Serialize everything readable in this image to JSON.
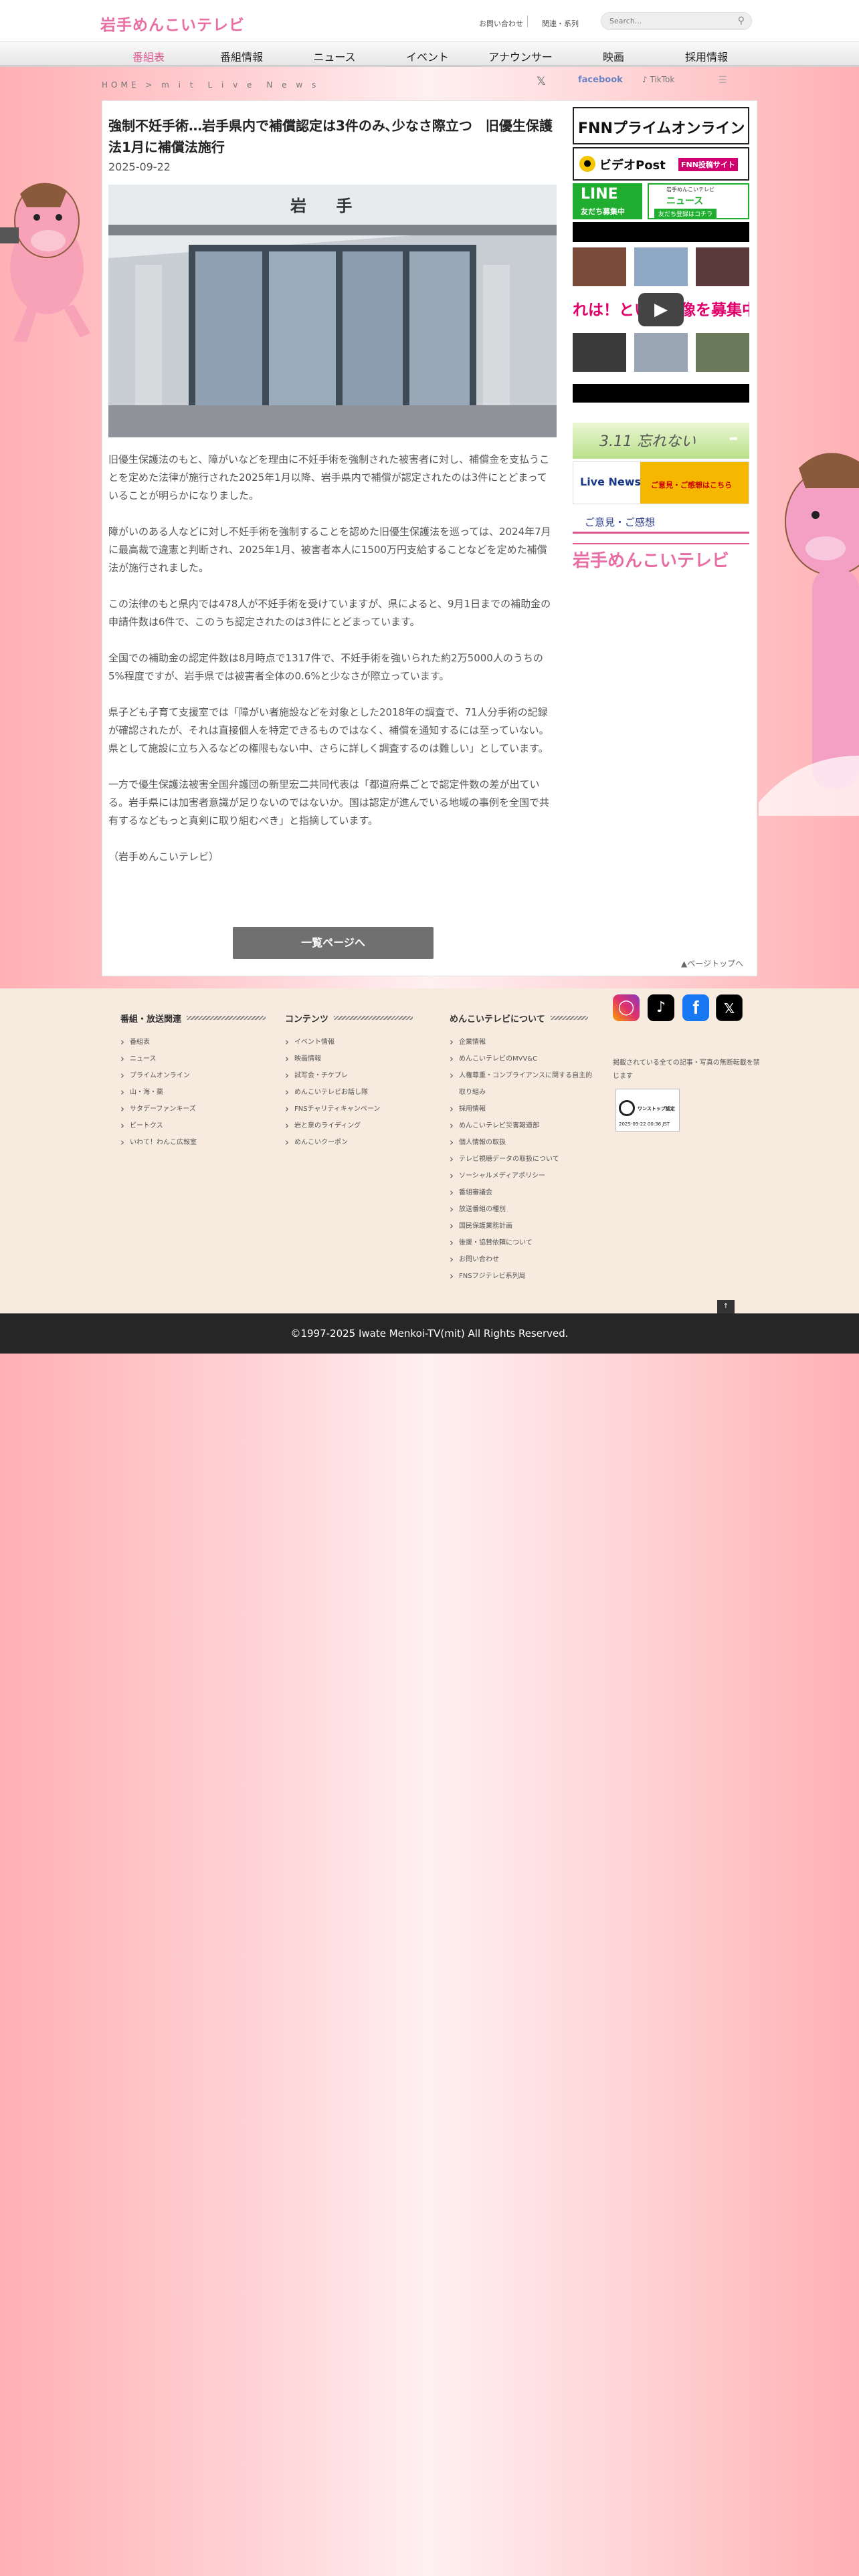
{
  "header": {
    "logo": "岩手めんこいテレビ",
    "links": [
      "お問い合わせ",
      "関連・系列"
    ],
    "search_placeholder": "Search..."
  },
  "nav": {
    "items": [
      "番組表",
      "番組情報",
      "ニュース",
      "イベント",
      "アナウンサー",
      "映画",
      "採用情報"
    ]
  },
  "breadcrumb": "HOME > m i t　L i v e　N e w s",
  "social": {
    "facebook": "facebook",
    "tiktok": "♪ TikTok"
  },
  "article": {
    "title": "強制不妊手術…岩手県内で補償認定は3件のみ､少なさ際立つ　旧優生保護法1月に補償法施行",
    "date": "2025-09-22",
    "photo_sign": "岩 手",
    "paragraphs": [
      "旧優生保護法のもと、障がいなどを理由に不妊手術を強制された被害者に対し、補償金を支払うことを定めた法律が施行された2025年1月以降、岩手県内で補償が認定されたのは3件にとどまっていることが明らかになりました。",
      "障がいのある人などに対し不妊手術を強制することを認めた旧優生保護法を巡っては、2024年7月に最高裁で違憲と判断され、2025年1月、被害者本人に1500万円支給することなどを定めた補償法が施行されました。",
      "この法律のもと県内では478人が不妊手術を受けていますが、県によると、9月1日までの補助金の申請件数は6件で、このうち認定されたのは3件にとどまっています。",
      "全国での補助金の認定件数は8月時点で1317件で、不妊手術を強いられた約2万5000人のうちの5%程度ですが、岩手県では被害者全体の0.6%と少なさが際立っています。",
      "県子ども子育て支援室では「障がい者施設などを対象とした2018年の調査で、71人分手術の記録が確認されたが、それは直接個人を特定できるものではなく、補償を通知するには至っていない。県として施設に立ち入るなどの権限もない中、さらに詳しく調査するのは難しい」としています。",
      "一方で優生保護法被害全国弁護団の新里宏二共同代表は「都道府県ごとで認定件数の差が出ている。岩手県には加害者意識が足りないのではないか。国は認定が進んでいる地域の事例を全国で共有するなどもっと真剣に取り組むべき」と指摘しています。",
      "（岩手めんこいテレビ）"
    ],
    "list_button": "一覧ページへ",
    "page_top": "▲ページトップへ"
  },
  "sidebar": {
    "fnn": "FNNプライムオンライン",
    "video_post": "ビデオPost",
    "video_post_sub": "FNN投稿サイト",
    "line_label": "LINE",
    "line_sub": "友だち募集中",
    "news_sub1": "岩手めんこいテレビ",
    "news_sub2": "ニュース",
    "news_sub3": "友だち登録はコチラ",
    "video_caption": "れは！という映像を募集中",
    "memorial": "3.11 忘れない",
    "live_news": "Live News",
    "live_news_sub": "ご意見・ご感想はこちら",
    "opinion": "ご意見・ご感想",
    "logo": "岩手めんこいテレビ"
  },
  "footer": {
    "columns": [
      {
        "title": "番組・放送関連",
        "items": [
          "番組表",
          "ニュース",
          "プライムオンライン",
          "山・海・薬",
          "サタデーファンキーズ",
          "ビートクス",
          "いわて！わんこ広報室"
        ]
      },
      {
        "title": "コンテンツ",
        "items": [
          "イベント情報",
          "映画情報",
          "試写会・チケプレ",
          "めんこいテレビお話し隊",
          "FNSチャリティキャンペーン",
          "岩と泉のライディング",
          "めんこいクーポン"
        ]
      },
      {
        "title": "めんこいテレビについて",
        "items": [
          "企業情報",
          "めんこいテレビのMVV&C",
          "人権尊重・コンプライアンスに関する自主的取り組み",
          "採用情報",
          "めんこいテレビ災害報道部",
          "個人情報の取扱",
          "テレビ視聴データの取扱について",
          "ソーシャルメディアポリシー",
          "番組審議会",
          "放送番組の種別",
          "国民保護業務計画",
          "後援・協賛依頼について",
          "お問い合わせ",
          "FNSフジテレビ系列局"
        ]
      }
    ],
    "notice": "掲載されている全ての記事・写真の無断転載を禁じます",
    "certified": "ワンストップ認定",
    "certified_date": "2025-09-22 00:36 JST",
    "copyright": "©1997-2025 Iwate Menkoi-TV(mit) All Rights Reserved."
  },
  "colors": {
    "brand_pink": "#e86ea3",
    "nav_active": "#e0578f",
    "footer_bg": "#f7eadf",
    "copyright_bg": "#262626"
  }
}
